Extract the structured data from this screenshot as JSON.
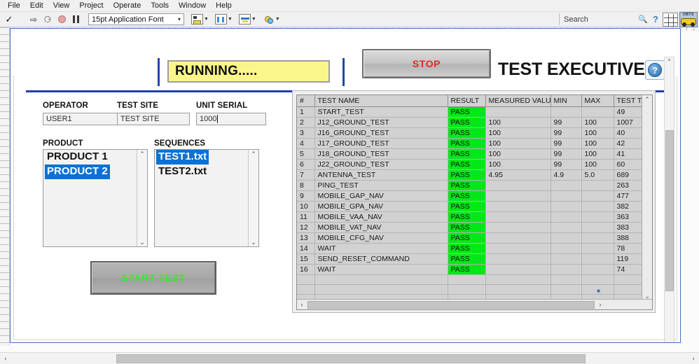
{
  "menubar": {
    "items": [
      "File",
      "Edit",
      "View",
      "Project",
      "Operate",
      "Tools",
      "Window",
      "Help"
    ]
  },
  "toolbar": {
    "run_icon": "run-arrow-icon",
    "run_continuous_icon": "run-continuously-icon",
    "abort_icon": "abort-execution-icon",
    "pause_icon": "pause-icon",
    "font_selector_value": "15pt Application Font",
    "font_selector_caret": "▾",
    "align_label": "align-objects",
    "distribute_label": "distribute-objects",
    "resize_label": "resize-objects",
    "reorder_label": "reorder-objects",
    "search_placeholder": "Search",
    "search_value": "",
    "search_icon": "magnifier-icon",
    "help_icon": "question-mark-icon",
    "grid_icon": "grid-icon",
    "project_icon_label": "OBTS"
  },
  "header": {
    "status_text": "RUNNING.....",
    "stop_button": "STOP",
    "app_title": "TEST EXECUTIVE",
    "help_button_glyph": "?"
  },
  "form": {
    "operator_label": "OPERATOR",
    "operator_value": "USER1",
    "test_site_label": "TEST SITE",
    "test_site_value": "TEST SITE",
    "unit_serial_label": "UNIT SERIAL",
    "unit_serial_value": "1000",
    "product_label": "PRODUCT",
    "sequences_label": "SEQUENCES",
    "product_items": [
      {
        "label": "PRODUCT 1",
        "selected": false
      },
      {
        "label": "PRODUCT 2",
        "selected": true
      }
    ],
    "sequence_items": [
      {
        "label": "TEST1.txt",
        "selected": true
      },
      {
        "label": "TEST2.txt",
        "selected": false
      }
    ],
    "start_button": "START TEST"
  },
  "results_table": {
    "headers": [
      "#",
      "TEST NAME",
      "RESULT",
      "MEASURED VALUE",
      "MIN",
      "MAX",
      "TEST TIM"
    ],
    "rows": [
      {
        "idx": "1",
        "name": "START_TEST",
        "result": "PASS",
        "measured": "",
        "min": "",
        "max": "",
        "time": "49"
      },
      {
        "idx": "2",
        "name": "J12_GROUND_TEST",
        "result": "PASS",
        "measured": "100",
        "min": "99",
        "max": "100",
        "time": "1007"
      },
      {
        "idx": "3",
        "name": "J16_GROUND_TEST",
        "result": "PASS",
        "measured": "100",
        "min": "99",
        "max": "100",
        "time": "40"
      },
      {
        "idx": "4",
        "name": "J17_GROUND_TEST",
        "result": "PASS",
        "measured": "100",
        "min": "99",
        "max": "100",
        "time": "42"
      },
      {
        "idx": "5",
        "name": "J18_GROUND_TEST",
        "result": "PASS",
        "measured": "100",
        "min": "99",
        "max": "100",
        "time": "41"
      },
      {
        "idx": "6",
        "name": "J22_GROUND_TEST",
        "result": "PASS",
        "measured": "100",
        "min": "99",
        "max": "100",
        "time": "60"
      },
      {
        "idx": "7",
        "name": "ANTENNA_TEST",
        "result": "PASS",
        "measured": "4.95",
        "min": "4.9",
        "max": "5.0",
        "time": "689"
      },
      {
        "idx": "8",
        "name": "PING_TEST",
        "result": "PASS",
        "measured": "",
        "min": "",
        "max": "",
        "time": "263"
      },
      {
        "idx": "9",
        "name": "MOBILE_GAP_NAV",
        "result": "PASS",
        "measured": "",
        "min": "",
        "max": "",
        "time": "477"
      },
      {
        "idx": "10",
        "name": "MOBILE_GPA_NAV",
        "result": "PASS",
        "measured": "",
        "min": "",
        "max": "",
        "time": "382"
      },
      {
        "idx": "11",
        "name": "MOBILE_VAA_NAV",
        "result": "PASS",
        "measured": "",
        "min": "",
        "max": "",
        "time": "363"
      },
      {
        "idx": "12",
        "name": "MOBILE_VAT_NAV",
        "result": "PASS",
        "measured": "",
        "min": "",
        "max": "",
        "time": "383"
      },
      {
        "idx": "13",
        "name": "MOBILE_CFG_NAV",
        "result": "PASS",
        "measured": "",
        "min": "",
        "max": "",
        "time": "388"
      },
      {
        "idx": "14",
        "name": "WAIT",
        "result": "PASS",
        "measured": "",
        "min": "",
        "max": "",
        "time": "78"
      },
      {
        "idx": "15",
        "name": "SEND_RESET_COMMAND",
        "result": "PASS",
        "measured": "",
        "min": "",
        "max": "",
        "time": "119"
      },
      {
        "idx": "16",
        "name": "WAIT",
        "result": "PASS",
        "measured": "",
        "min": "",
        "max": "",
        "time": "74"
      },
      {
        "idx": "",
        "name": "",
        "result": "",
        "measured": "",
        "min": "",
        "max": "",
        "time": ""
      },
      {
        "idx": "",
        "name": "",
        "result": "",
        "measured": "",
        "min": "",
        "max": "",
        "time": ""
      },
      {
        "idx": "",
        "name": "",
        "result": "",
        "measured": "",
        "min": "",
        "max": "",
        "time": ""
      },
      {
        "idx": "",
        "name": "",
        "result": "",
        "measured": "",
        "min": "",
        "max": "",
        "time": ""
      }
    ],
    "scroll_up_arrow": "⌃",
    "scroll_down_arrow": "⌄",
    "scroll_left_arrow": "‹",
    "scroll_right_arrow": "›"
  },
  "scrollbars": {
    "up_arrow": "⌃",
    "down_arrow": "⌄",
    "left_arrow": "‹",
    "right_arrow": "›"
  },
  "colors": {
    "status_background": "#fbf68c",
    "stop_text": "#ee2222",
    "start_text": "#2bf02b",
    "pass_cell": "#00e817",
    "selection_blue": "#0a72d6",
    "rule_blue": "#1f3fb0",
    "panel_border": "#3f72c4"
  }
}
